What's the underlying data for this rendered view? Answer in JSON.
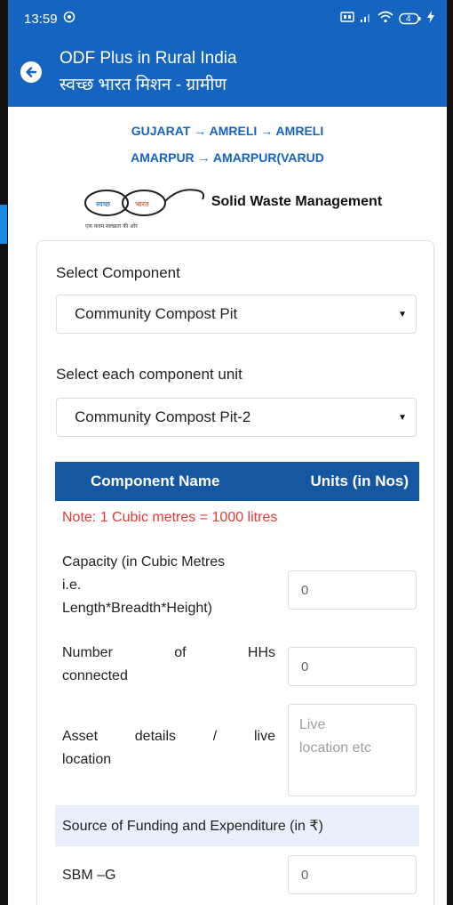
{
  "status_bar": {
    "time": "13:59",
    "battery": "4"
  },
  "app_bar": {
    "title": "ODF Plus in Rural India",
    "subtitle": "स्वच्छ भारत मिशन - ग्रामीण"
  },
  "breadcrumb": {
    "line1": "GUJARAT → AMRELI → AMRELI",
    "line2": "AMARPUR → AMARPUR(VARUD"
  },
  "logo": {
    "word1": "स्वच्छ",
    "word2": "भारत",
    "tagline": "एक कदम स्वच्छता की ओर",
    "section_title": "Solid Waste Management"
  },
  "form": {
    "component_label": "Select Component",
    "component_value": "Community Compost Pit",
    "unit_label": "Select each component unit",
    "unit_value": "Community Compost Pit-2",
    "table_header": {
      "col1": "Component Name",
      "col2": "Units (in Nos)"
    },
    "note": "Note: 1 Cubic metres = 1000 litres",
    "capacity": {
      "line1": "Capacity (in Cubic Metres",
      "line2": "i.e.",
      "line3": "Length*Breadth*Height)",
      "value": "0"
    },
    "households": {
      "line1": "Number of HHs",
      "line2": "connected",
      "value": "0"
    },
    "asset": {
      "line1": "Asset details / live",
      "line2": "location",
      "placeholder_line1": "Live",
      "placeholder_line2": "location etc"
    },
    "funding_header": "Source of Funding and Expenditure (in ₹)",
    "sbm": {
      "label": "SBM –G",
      "value": "0"
    }
  },
  "colors": {
    "primary": "#1565c0",
    "table_header": "#1557a0",
    "note": "#e53935",
    "section_band": "#e8f0fb"
  }
}
